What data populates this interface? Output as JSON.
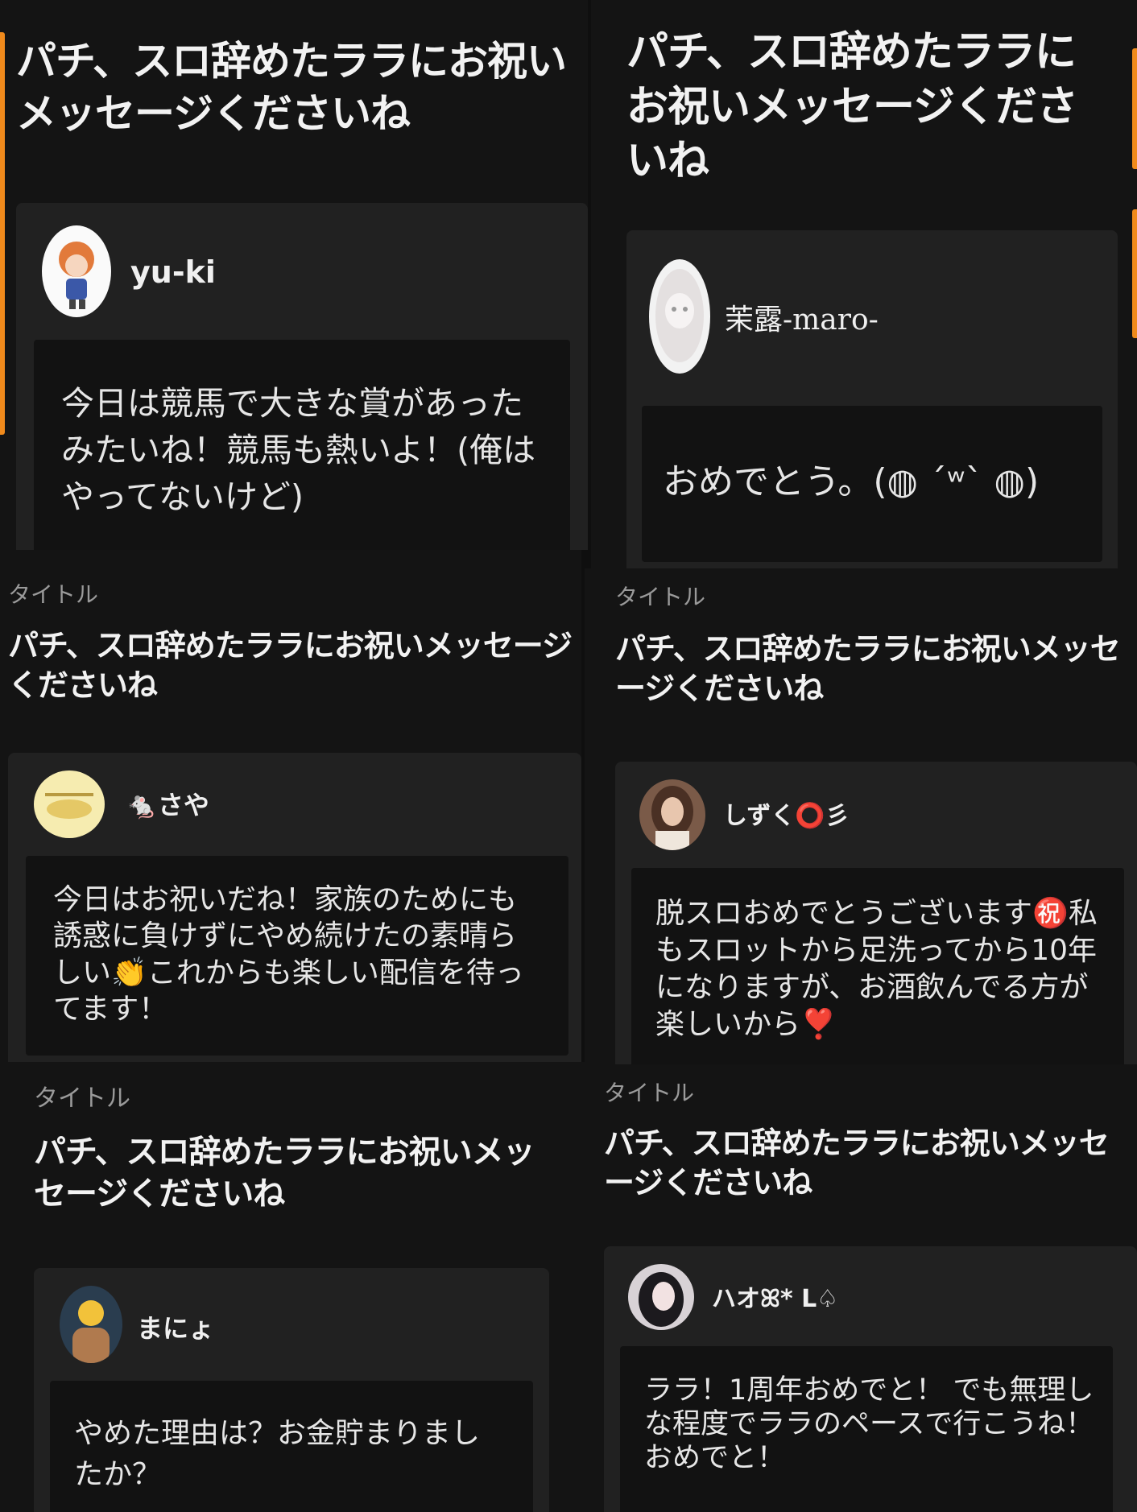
{
  "panels": [
    {
      "label": "タイトル",
      "headline": "パチ、スロ辞めたララにお祝いメッセージくださいね",
      "user": "yu-ki",
      "message": "今日は競馬で大きな賞があったみたいね！競馬も熱いよ！(俺はやってないけど)"
    },
    {
      "headline": "パチ、スロ辞めたララにお祝いメッセージくださいね",
      "user": "茉露-maro-",
      "message": "おめでとう。(◍ ´ʷ` ◍)"
    },
    {
      "label": "タイトル",
      "headline": "パチ、スロ辞めたララにお祝いメッセージくださいね",
      "user": "🐁さや",
      "message": "今日はお祝いだね！家族のためにも誘惑に負けずにやめ続けたの素晴らしい👏これからも楽しい配信を待ってます！"
    },
    {
      "label": "タイトル",
      "headline": "パチ、スロ辞めたララにお祝いメッセージくださいね",
      "user": "しずく⭕️彡",
      "message": "脱スロおめでとうございます㊗️私もスロットから足洗ってから10年になりますが、お酒飲んでる方が楽しいから❣️"
    },
    {
      "label": "タイトル",
      "headline": "パチ、スロ辞めたララにお祝いメッセージくださいね",
      "user": "まにょ",
      "message": "やめた理由は？お金貯まりましたか？"
    },
    {
      "label": "タイトル",
      "headline": "パチ、スロ辞めたララにお祝いメッセージくださいね",
      "user": "ハオꕤ* L♤",
      "message": "ララ！1周年おめでと！ でも無理しな程度でララのペースで行こうね！おめでと！"
    }
  ],
  "colors": {
    "background": "#0f0f0f",
    "card": "#212121",
    "message_box": "#121212",
    "accent": "#f08a1c"
  }
}
